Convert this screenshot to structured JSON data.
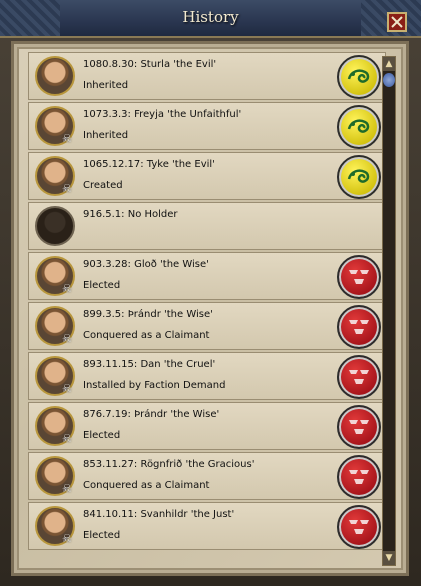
{
  "window": {
    "title": "History"
  },
  "rows": [
    {
      "title": "1080.8.30: Sturla 'the Evil'",
      "sub": "Inherited",
      "coa": "yellow",
      "portrait": "portrait",
      "skull": false
    },
    {
      "title": "1073.3.3: Freyja 'the Unfaithful'",
      "sub": "Inherited",
      "coa": "yellow",
      "portrait": "portrait",
      "skull": true
    },
    {
      "title": "1065.12.17: Tyke 'the Evil'",
      "sub": "Created",
      "coa": "yellow",
      "portrait": "portrait",
      "skull": true
    },
    {
      "title": "916.5.1: No Holder",
      "sub": "",
      "coa": "",
      "portrait": "silhouette",
      "skull": false
    },
    {
      "title": "903.3.28: Gloð 'the Wise'",
      "sub": "Elected",
      "coa": "red",
      "portrait": "portrait",
      "skull": true
    },
    {
      "title": "899.3.5: Þrándr 'the Wise'",
      "sub": "Conquered as a Claimant",
      "coa": "red",
      "portrait": "portrait",
      "skull": true
    },
    {
      "title": "893.11.15: Dan 'the Cruel'",
      "sub": "Installed by Faction Demand",
      "coa": "red",
      "portrait": "portrait",
      "skull": true
    },
    {
      "title": "876.7.19: Þrándr 'the Wise'",
      "sub": "Elected",
      "coa": "red",
      "portrait": "portrait",
      "skull": true
    },
    {
      "title": "853.11.27: Rögnfrið 'the Gracious'",
      "sub": "Conquered as a Claimant",
      "coa": "red",
      "portrait": "portrait",
      "skull": true
    },
    {
      "title": "841.10.11: Svanhildr 'the Just'",
      "sub": "Elected",
      "coa": "red",
      "portrait": "portrait",
      "skull": true
    }
  ],
  "icons": {
    "close": "close-icon",
    "skull": "skull-icon",
    "scroll_up": "arrow-up-icon",
    "scroll_down": "arrow-down-icon"
  },
  "colors": {
    "title_bar": "#2a3650",
    "parchment": "#d3c8ae",
    "coa_yellow": "#d2c10e",
    "coa_red": "#a5131a"
  }
}
